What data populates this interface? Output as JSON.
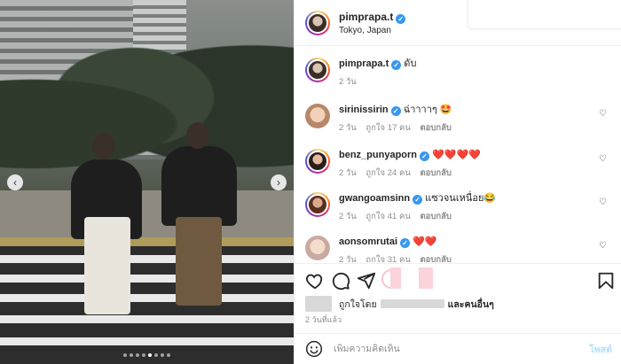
{
  "post": {
    "username": "pimprapa.t",
    "location": "Tokyo, Japan",
    "caption_user": "pimprapa.t",
    "caption_text": "ดับ",
    "caption_time": "2 วัน",
    "carousel_dots": 8,
    "carousel_active_index": 4
  },
  "comments": [
    {
      "username": "sirinissirin",
      "text": "ฉ่าาาาๆ 🤩",
      "time": "2 วัน",
      "likes": "ถูกใจ 17 คน",
      "reply": "ตอบกลับ"
    },
    {
      "username": "benz_punyaporn",
      "text": "❤️❤️❤️❤️",
      "time": "2 วัน",
      "likes": "ถูกใจ 24 คน",
      "reply": "ตอบกลับ"
    },
    {
      "username": "gwangoamsinn",
      "text": "แซวจนเหนื่อย😂",
      "time": "2 วัน",
      "likes": "ถูกใจ 41 คน",
      "reply": "ตอบกลับ"
    },
    {
      "username": "aonsomrutai",
      "text": "❤️❤️",
      "time": "2 วัน",
      "likes": "ถูกใจ 31 คน",
      "reply": "ตอบกลับ"
    }
  ],
  "likes": {
    "prefix": "ถูกใจโดย",
    "suffix": "และคนอื่นๆ"
  },
  "post_time": "2 วันที่แล้ว",
  "comment_box": {
    "placeholder": "เพิ่มความคิดเห็น",
    "post_label": "โพสต์"
  },
  "icons": {
    "like": "heart-icon",
    "comment": "comment-icon",
    "share": "share-icon",
    "save": "bookmark-icon",
    "emoji": "emoji-icon",
    "prev": "chevron-left-icon",
    "next": "chevron-right-icon"
  },
  "colors": {
    "verified": "#3897f0",
    "link_muted": "#8e8e8e",
    "post_button": "#b2dffc"
  }
}
